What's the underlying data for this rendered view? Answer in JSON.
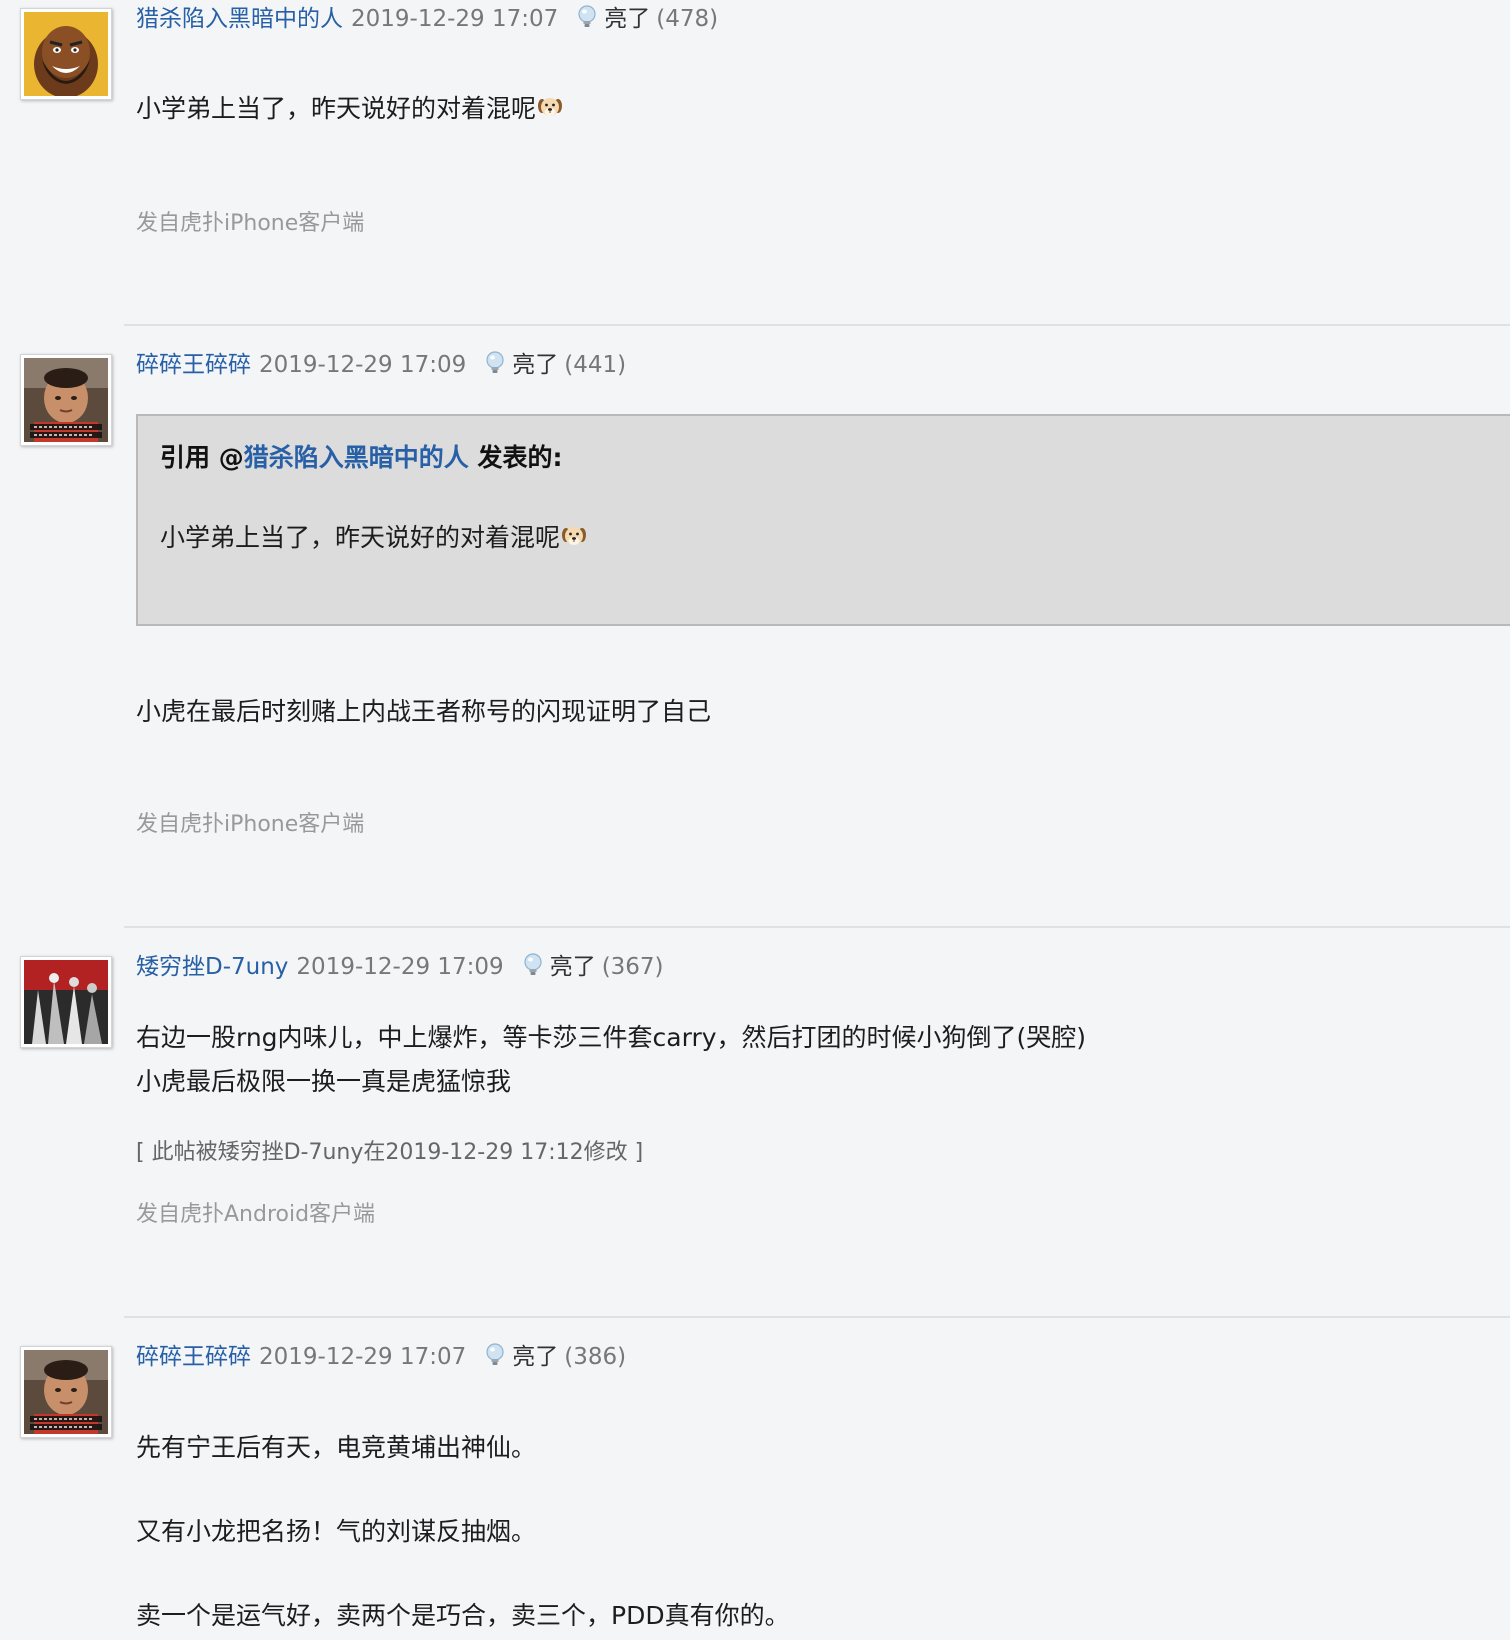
{
  "posts": [
    {
      "author": "猎杀陷入黑暗中的人",
      "time": "2019-12-29 17:07",
      "liang_label": "亮了",
      "liang_count": "(478)",
      "content": "小学弟上当了，昨天说好的对着混呢",
      "source": "发自虎扑iPhone客户端"
    },
    {
      "author": "碎碎王碎碎",
      "time": "2019-12-29 17:09",
      "liang_label": "亮了",
      "liang_count": "(441)",
      "quote": {
        "prefix": "引用 @",
        "author": "猎杀陷入黑暗中的人",
        "suffix": " 发表的:",
        "content": "小学弟上当了，昨天说好的对着混呢"
      },
      "content": "小虎在最后时刻赌上内战王者称号的闪现证明了自己",
      "source": "发自虎扑iPhone客户端"
    },
    {
      "author": "矮穷挫D-7uny",
      "time": "2019-12-29 17:09",
      "liang_label": "亮了",
      "liang_count": "(367)",
      "content_lines": [
        "右边一股rng内味儿，中上爆炸，等卡莎三件套carry，然后打团的时候小狗倒了(哭腔)",
        "小虎最后极限一换一真是虎猛惊我"
      ],
      "edit_note": "[ 此帖被矮穷挫D-7uny在2019-12-29 17:12修改 ]",
      "source": "发自虎扑Android客户端"
    },
    {
      "author": "碎碎王碎碎",
      "time": "2019-12-29 17:07",
      "liang_label": "亮了",
      "liang_count": "(386)",
      "content_lines": [
        "先有宁王后有天，电竞黄埔出神仙。",
        "又有小龙把名扬！气的刘谋反抽烟。",
        " 卖一个是运气好，卖两个是巧合，卖三个，PDD真有你的。"
      ]
    }
  ],
  "colors": {
    "background": "#f3f5f7",
    "author_link": "#2760a6",
    "quote_bg": "#dcdcdc"
  }
}
